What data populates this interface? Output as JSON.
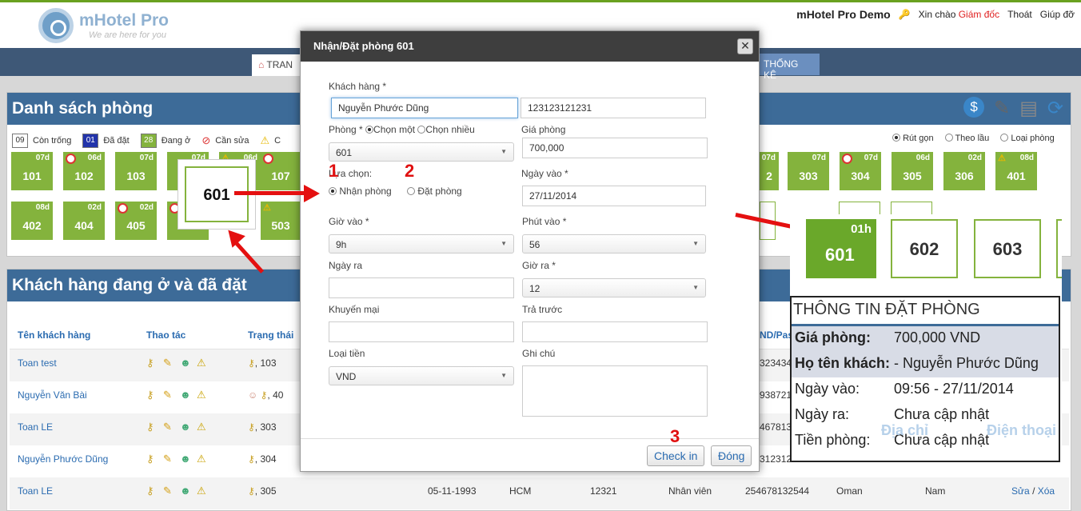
{
  "header": {
    "brand": "mHotel Pro",
    "tagline": "We are here for you",
    "demo": "mHotel Pro Demo",
    "greeting": "Xin chào",
    "user": "Giám đốc",
    "logout": "Thoát",
    "help": "Giúp đỡ"
  },
  "nav": {
    "home": "TRAN",
    "stats": "THỐNG KÊ"
  },
  "rooms_panel": {
    "title": "Danh sách phòng",
    "legend": [
      {
        "count": "09",
        "label": "Còn trống"
      },
      {
        "count": "01",
        "label": "Đã đặt"
      },
      {
        "count": "28",
        "label": "Đang ở"
      },
      {
        "label": "Cần sửa"
      },
      {
        "label": "C"
      }
    ],
    "views": [
      "Rút gọn",
      "Theo lầu",
      "Loại phòng"
    ],
    "row1": [
      {
        "num": "101",
        "dur": "07d"
      },
      {
        "num": "102",
        "dur": "06d"
      },
      {
        "num": "103",
        "dur": "07d"
      },
      {
        "num": "",
        "dur": "07d"
      },
      {
        "num": "",
        "dur": "06d"
      },
      {
        "num": "107",
        "dur": ""
      }
    ],
    "row1_right": [
      {
        "num": "2",
        "dur": "07d"
      },
      {
        "num": "303",
        "dur": "07d"
      },
      {
        "num": "304",
        "dur": "07d"
      },
      {
        "num": "305",
        "dur": "06d"
      },
      {
        "num": "306",
        "dur": "02d"
      },
      {
        "num": "401",
        "dur": "08d"
      }
    ],
    "row2": [
      {
        "num": "402",
        "dur": "08d"
      },
      {
        "num": "404",
        "dur": "02d"
      },
      {
        "num": "405",
        "dur": "02d"
      },
      {
        "num": "",
        "dur": ""
      },
      {
        "num": "",
        "dur": ""
      },
      {
        "num": "503",
        "dur": ""
      }
    ]
  },
  "guests_panel": {
    "title": "Khách hàng đang ở và đã đặt",
    "columns": {
      "name": "Tên khách hàng",
      "actions": "Thao tác",
      "status": "Trạng thái",
      "passport": "ND/Pas"
    },
    "rows": [
      {
        "name": "Toan test",
        "room": ", 103",
        "passport": "323434"
      },
      {
        "name": "Nguyễn Văn Bài",
        "room": ", 40",
        "passport": "938721"
      },
      {
        "name": "Toan LE",
        "room": ", 303",
        "passport": "467813"
      },
      {
        "name": "Nguyễn Phước Dũng",
        "room": ", 304",
        "passport": "312312"
      },
      {
        "name": "Toan LE",
        "room": ", 305",
        "dob": "05-11-1993",
        "city": "HCM",
        "code": "12321",
        "role": "Nhân viên",
        "passport": "254678132544",
        "country": "Oman",
        "gender": "Nam",
        "edit": "Sửa",
        "sep": "/",
        "delete": "Xóa"
      }
    ]
  },
  "modal": {
    "title": "Nhận/Đặt phòng 601",
    "customer_label": "Khách hàng *",
    "customer_value": "Nguyễn Phước Dũng",
    "id_value": "123123121231",
    "room_label": "Phòng *",
    "choose_one": "Chọn một",
    "choose_many": "Chọn nhiều",
    "room_value": "601",
    "price_label": "Giá phòng",
    "price_value": "700,000",
    "option_label": "Lựa chọn:",
    "checkin_opt": "Nhận phòng",
    "book_opt": "Đặt phòng",
    "date_in_label": "Ngày vào *",
    "date_in_value": "27/11/2014",
    "hour_in_label": "Giờ vào *",
    "hour_in_value": "9h",
    "min_in_label": "Phút vào *",
    "min_in_value": "56",
    "date_out_label": "Ngày ra",
    "hour_out_label": "Giờ ra *",
    "hour_out_value": "12",
    "promo_label": "Khuyến mại",
    "prepaid_label": "Trả trước",
    "currency_label": "Loại tiền",
    "currency_value": "VND",
    "note_label": "Ghi chú",
    "checkin_btn": "Check in",
    "close_btn": "Đóng"
  },
  "annotations": {
    "n1": "1",
    "n2": "2",
    "n3": "3",
    "zoom_room": "601"
  },
  "callout": {
    "rooms": [
      {
        "num": "601",
        "dur": "01h"
      },
      {
        "num": "602"
      },
      {
        "num": "603"
      }
    ],
    "info_title": "THÔNG TIN ĐẶT PHÒNG",
    "rows": [
      {
        "k": "Giá phòng:",
        "v": "700,000 VND"
      },
      {
        "k": "Họ tên khách:",
        "v": "- Nguyễn Phước Dũng"
      },
      {
        "k": "Ngày vào:",
        "v": "09:56 - 27/11/2014"
      },
      {
        "k": "Ngày ra:",
        "v": "Chưa cập nhật"
      },
      {
        "k": "Tiền phòng:",
        "v": "Chưa cập nhật"
      }
    ],
    "bg_address": "Địa chỉ",
    "bg_phone": "Điện thoại"
  },
  "colors": {
    "green": "#84b33d",
    "navy": "#3e5877",
    "panel_head": "#3d6b98",
    "red": "#e41010"
  }
}
